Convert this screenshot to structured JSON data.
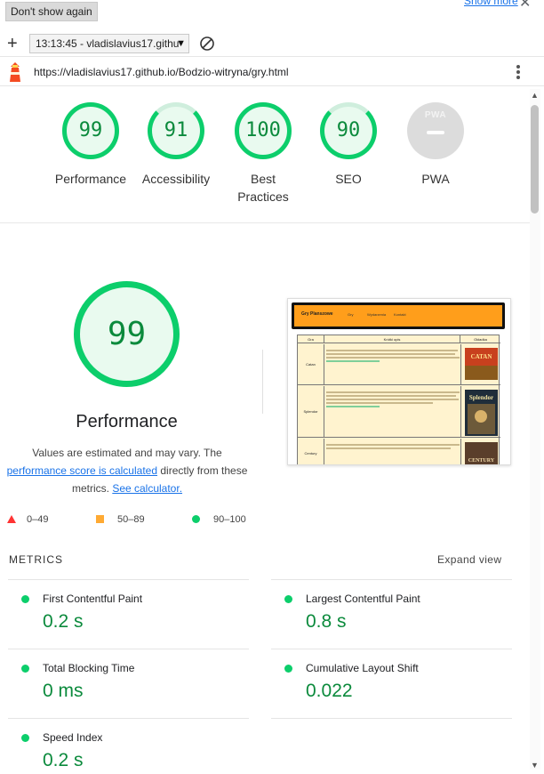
{
  "topbar": {
    "dont_show_label": "Don't show again",
    "show_more_label": "Show more"
  },
  "toolbar": {
    "report_select_value": "13:13:45 - vladislavius17.githu"
  },
  "urlbar": {
    "url": "https://vladislavius17.github.io/Bodzio-witryna/gry.html"
  },
  "gauges": [
    {
      "label": "Performance",
      "score": "99"
    },
    {
      "label": "Accessibility",
      "score": "91"
    },
    {
      "label": "Best Practices",
      "score": "100"
    },
    {
      "label": "SEO",
      "score": "90"
    },
    {
      "label": "PWA",
      "score": ""
    }
  ],
  "pwa_badge_text": "PWA",
  "performance": {
    "score": "99",
    "title": "Performance",
    "desc_pre": "Values are estimated and may vary. The",
    "link_score": "performance score is calculated",
    "desc_mid": "directly from these metrics.",
    "link_calc": "See calculator."
  },
  "legend": {
    "fail": "0–49",
    "average": "50–89",
    "pass": "90–100"
  },
  "metrics_section": {
    "title": "METRICS",
    "expand_label": "Expand view"
  },
  "metrics": [
    {
      "name": "First Contentful Paint",
      "value": "0.2 s"
    },
    {
      "name": "Largest Contentful Paint",
      "value": "0.8 s"
    },
    {
      "name": "Total Blocking Time",
      "value": "0 ms"
    },
    {
      "name": "Cumulative Layout Shift",
      "value": "0.022"
    },
    {
      "name": "Speed Index",
      "value": "0.2 s"
    }
  ],
  "screenshot": {
    "logo": "Gry Planszowe",
    "nav": [
      "Gry",
      "Wydarzenia",
      "Kontakt"
    ],
    "headers": [
      "Gra",
      "Krótki opis",
      "Okładka"
    ],
    "rows": [
      "Catan",
      "Splendor",
      "Century"
    ],
    "covers": [
      "CATAN",
      "Splendor",
      "CENTURY"
    ]
  },
  "colors": {
    "pass": "#0cce6b",
    "average": "#ffaa33",
    "fail": "#ff3333",
    "link": "#1a73e8"
  }
}
